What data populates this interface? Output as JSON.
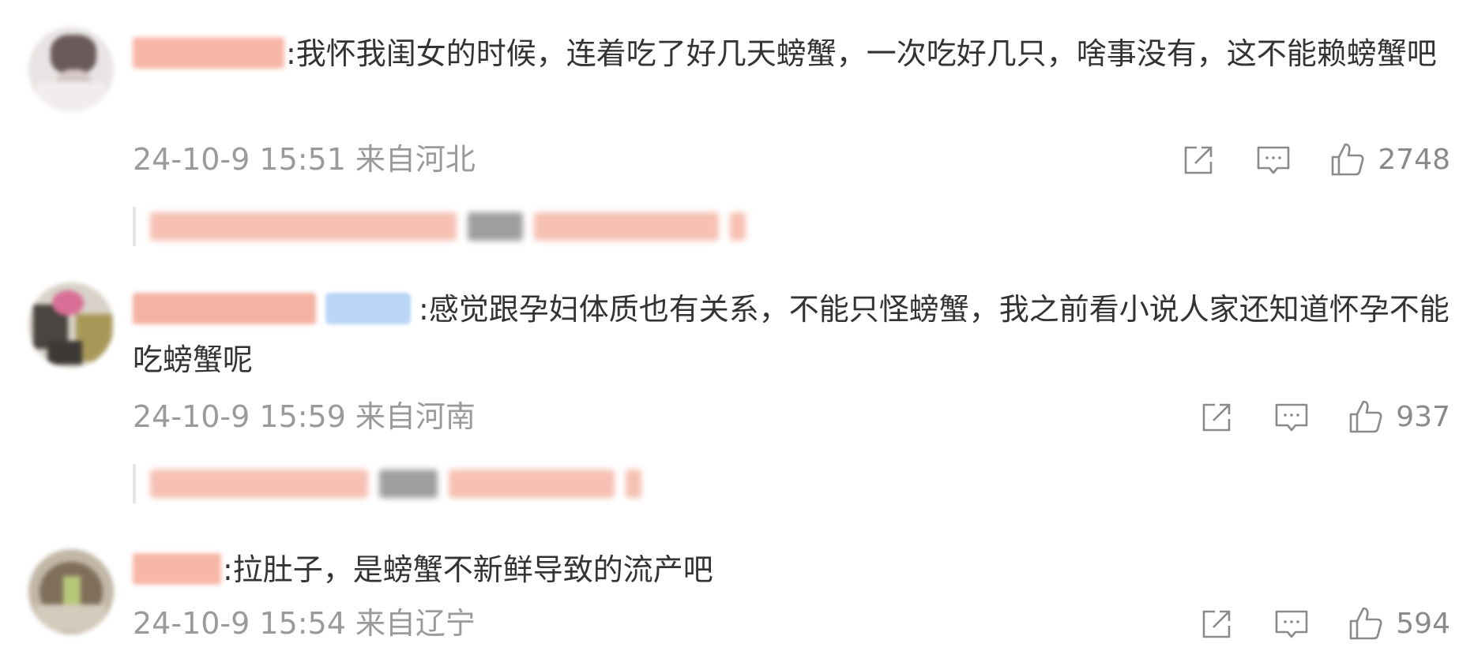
{
  "comments": [
    {
      "text": ":我怀我闺女的时候，连着吃了好几天螃蟹，一次吃好几只，啥事没有，这不能赖螃蟹吧",
      "time": "24-10-9 15:51",
      "location": "来自河北",
      "likes": "2748"
    },
    {
      "text": ":感觉跟孕妇体质也有关系，不能只怪螃蟹，我之前看小说人家还知道怀孕不能吃螃蟹呢",
      "time": "24-10-9 15:59",
      "location": "来自河南",
      "likes": "937"
    },
    {
      "text": ":拉肚子，是螃蟹不新鲜导致的流产吧",
      "time": "24-10-9 15:54",
      "location": "来自辽宁",
      "likes": "594"
    }
  ],
  "icons": {
    "share": "share-icon",
    "comment": "comment-icon",
    "like": "like-icon"
  },
  "colors": {
    "text": "#333333",
    "meta": "#9a9a9a",
    "blurred_name": "#f7b7a8",
    "badge": "#b9d6f6"
  }
}
